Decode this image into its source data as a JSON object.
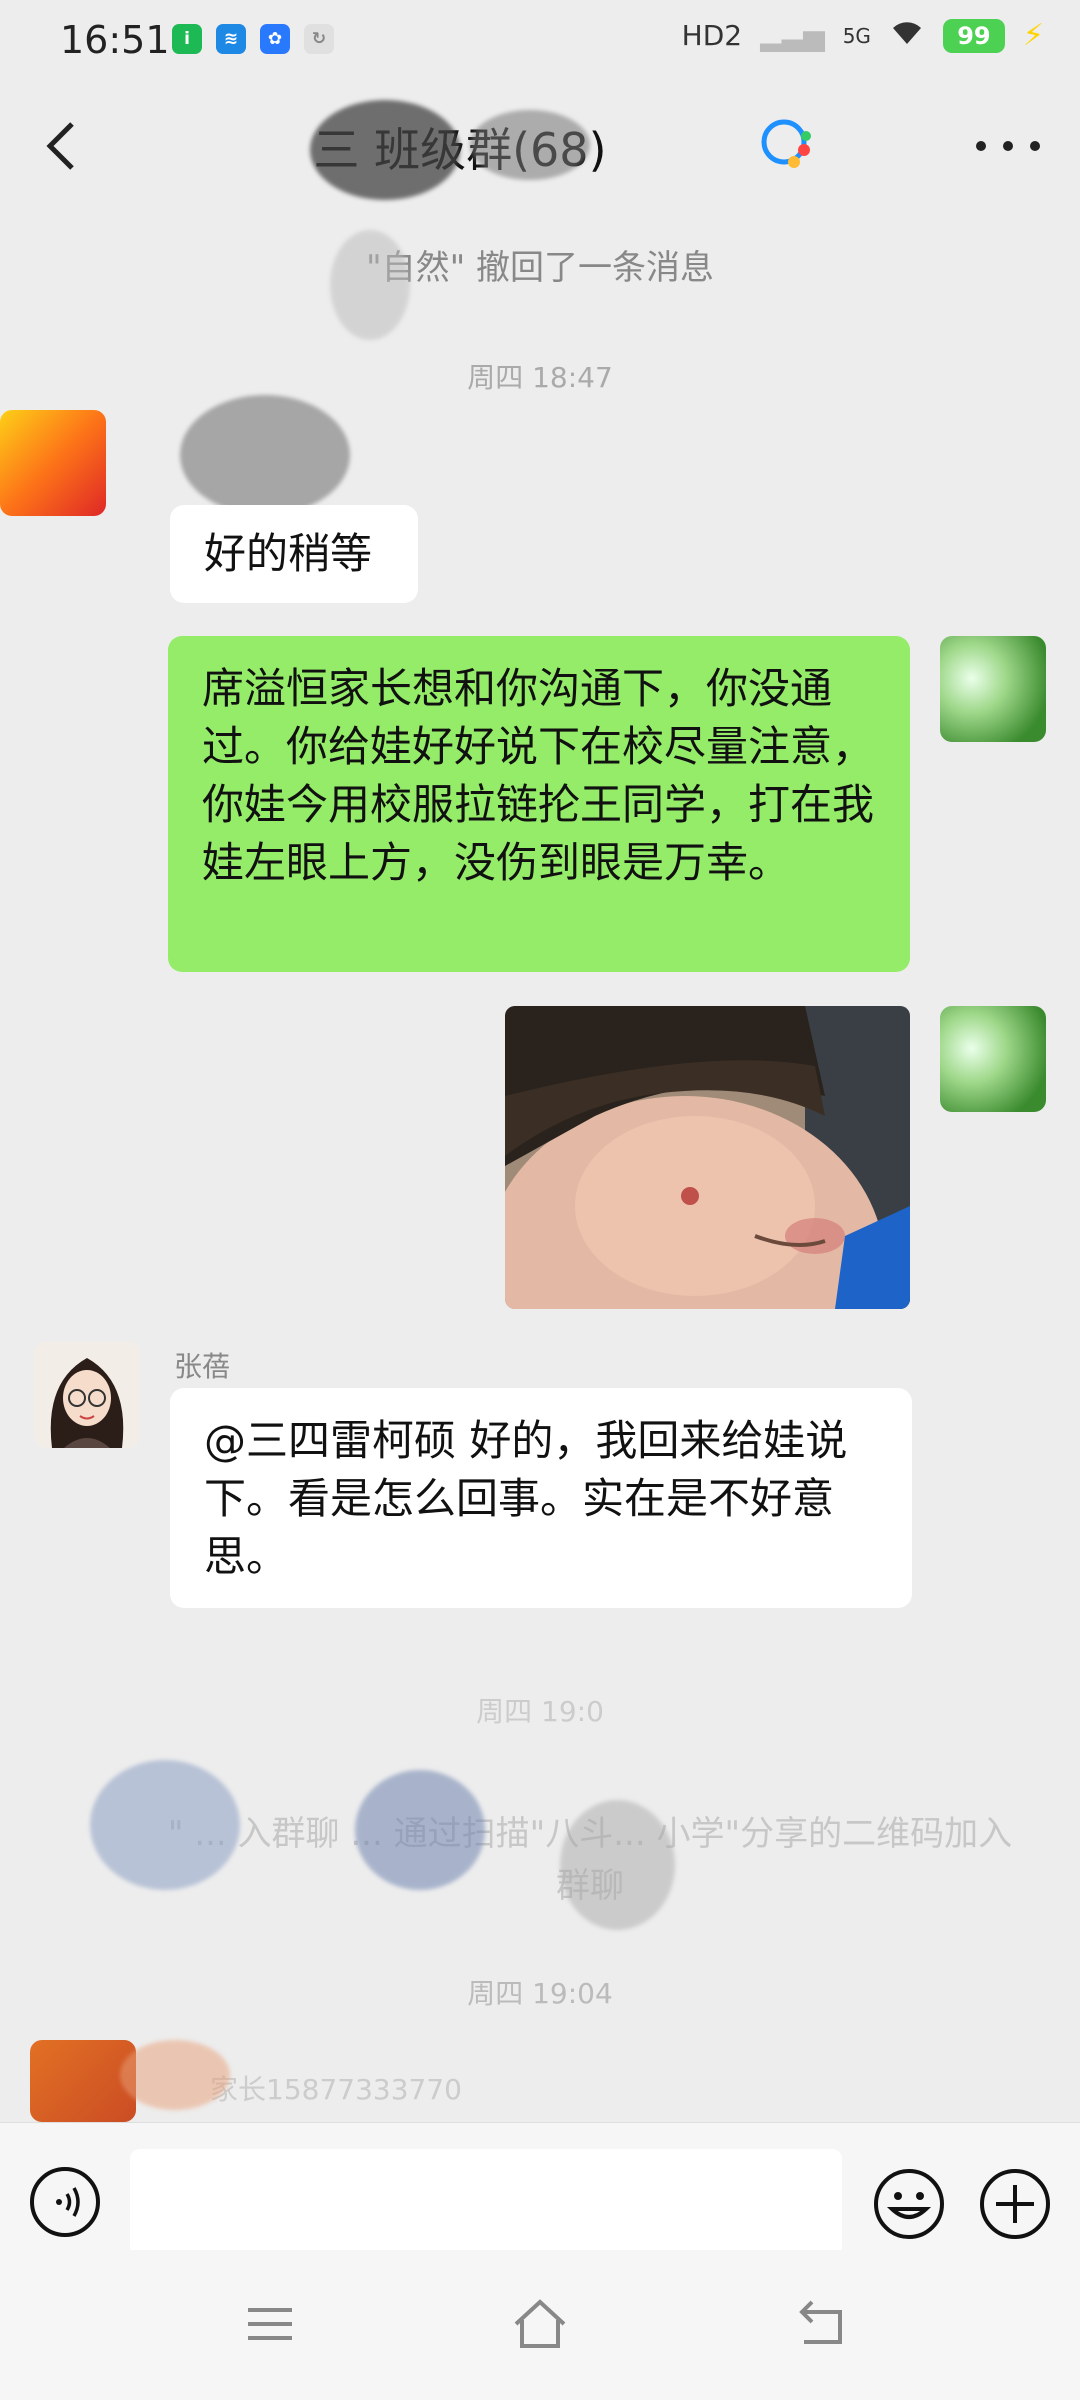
{
  "status_bar": {
    "time": "16:51",
    "hd_label": "HD2",
    "network": "5G",
    "battery": "99"
  },
  "header": {
    "title": "三   班级群(68)"
  },
  "messages": {
    "recall_notice": "\"自然\" 撤回了一条消息",
    "timestamp_1": "周四 18:47",
    "reply_short": "好的稍等",
    "green_text": "席溢恒家长想和你沟通下，你没通过。你给娃好好说下在校尽量注意，你娃今用校服拉链抡王同学，打在我娃左眼上方，没伤到眼是万幸。",
    "sender_name": "张蓓",
    "reply_long": "@三四雷柯硕           好的，我回来给娃说下。看是怎么回事。实在是不好意思。",
    "timestamp_2": "周四 19:0",
    "share_notice": "\"  ... 入群聊 ... 通过扫描\"八斗... 小学\"分享的二维码加入群聊",
    "timestamp_3": "周四 19:04",
    "last_sender": "家长15877333770"
  },
  "icons": {
    "back": "back-arrow-icon",
    "group": "group-chat-icon",
    "more": "more-dots-icon",
    "voice": "voice-icon",
    "emoji": "emoji-icon",
    "plus": "plus-icon"
  },
  "colors": {
    "bg": "#ededed",
    "green_bubble": "#95ec69",
    "white_bubble": "#ffffff"
  }
}
